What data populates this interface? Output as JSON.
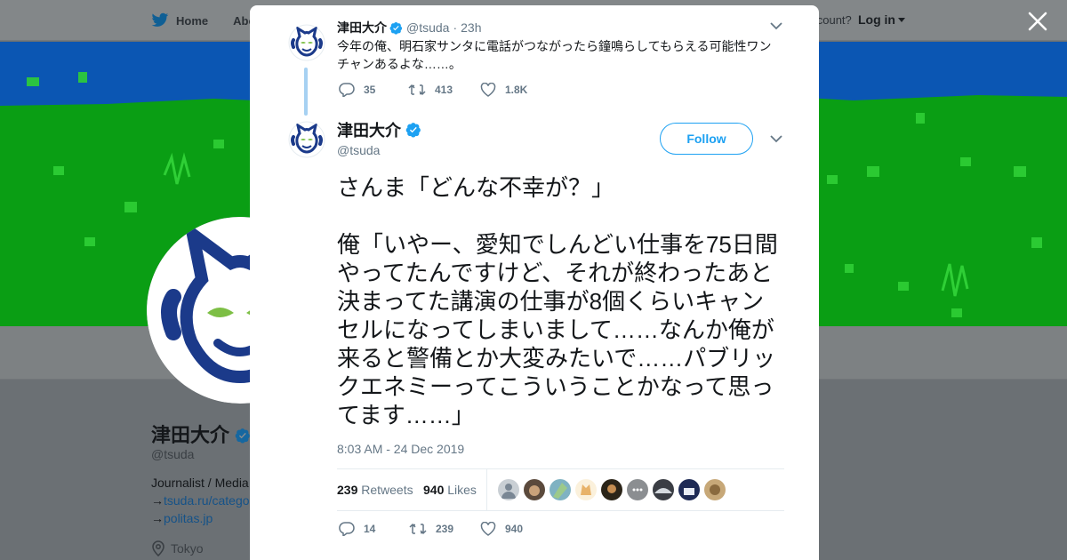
{
  "background_page": {
    "nav": {
      "home": "Home",
      "about": "Abo",
      "account": "account?",
      "login": "Log in"
    },
    "profile": {
      "name": "津田大介",
      "handle": "@tsuda",
      "bio": "Journalist / Media",
      "link1_prefix": "→",
      "link1": "tsuda.ru/catego",
      "link2_prefix": "→",
      "link2": "politas.jp",
      "location": "Tokyo"
    }
  },
  "parent_tweet": {
    "name": "津田大介",
    "handle": "@tsuda",
    "separator": "·",
    "age": "23h",
    "text": "今年の俺、明石家サンタに電話がつながったら鐘鳴らしてもらえる可能性ワンチャンあるよな……。",
    "replies": "35",
    "retweets": "413",
    "likes": "1.8K"
  },
  "main_tweet": {
    "name": "津田大介",
    "handle": "@tsuda",
    "follow_label": "Follow",
    "text": "さんま「どんな不幸が？」\n\n俺「いやー、愛知でしんどい仕事を75日間やってたんですけど、それが終わったあと決まってた講演の仕事が8個くらいキャンセルになってしまいまして……なんか俺が来ると警備とか大変みたいで……パブリックエネミーってこういうことかなって思ってます……」",
    "timestamp": "8:03 AM - 24 Dec 2019",
    "retweet_count": "239",
    "retweet_label": "Retweets",
    "like_count": "940",
    "like_label": "Likes",
    "replies": "14",
    "retweets": "239",
    "likes": "940"
  },
  "colors": {
    "accent": "#1da1f2",
    "verified": "#1da1f2",
    "avatar_navy": "#1b3a8a",
    "avatar_green": "#7dbf45",
    "banner_blue": "#0b56b3",
    "banner_green": "#0a9e14"
  },
  "icons": [
    "twitter-bird-icon",
    "verified-badge-icon",
    "reply-icon",
    "retweet-icon",
    "like-icon",
    "chevron-down-icon",
    "close-icon",
    "location-pin-icon"
  ]
}
